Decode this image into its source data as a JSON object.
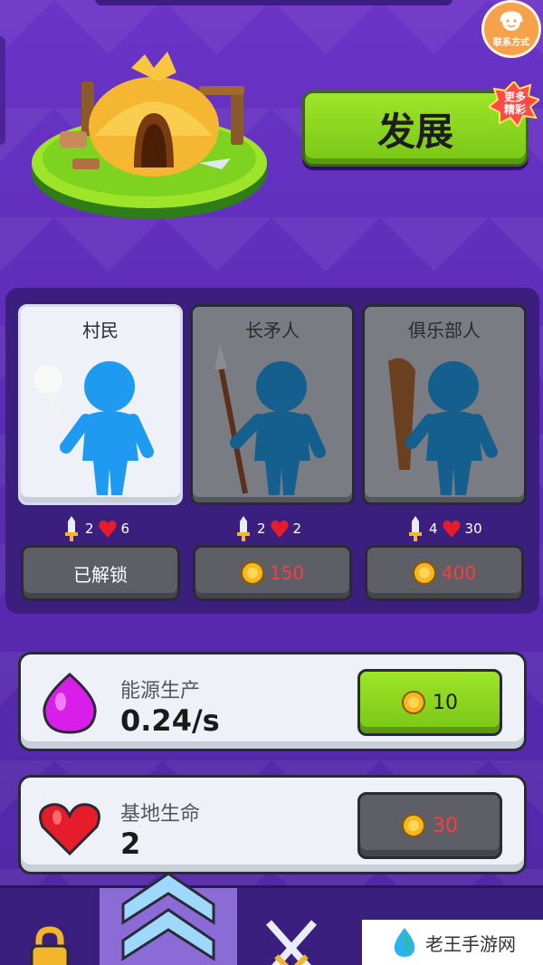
{
  "header": {
    "contact_label": "联系方式",
    "develop_label": "发展",
    "more_badge": [
      "更多",
      "精彩"
    ]
  },
  "units": [
    {
      "name": "村民",
      "attack": "2",
      "health": "6",
      "button": "已解锁",
      "state": "unlocked"
    },
    {
      "name": "长矛人",
      "attack": "2",
      "health": "2",
      "button": "150",
      "state": "locked"
    },
    {
      "name": "俱乐部人",
      "attack": "4",
      "health": "30",
      "button": "400",
      "state": "locked"
    }
  ],
  "upgrades": {
    "energy": {
      "title": "能源生产",
      "value": "0.24/s",
      "cost": "10"
    },
    "base_health": {
      "title": "基地生命",
      "value": "2",
      "cost": "30"
    }
  },
  "watermark": "老王手游网",
  "colors": {
    "accent_green": "#8fd822",
    "price_red": "#ff3b3b",
    "panel": "#3b1f7f"
  }
}
